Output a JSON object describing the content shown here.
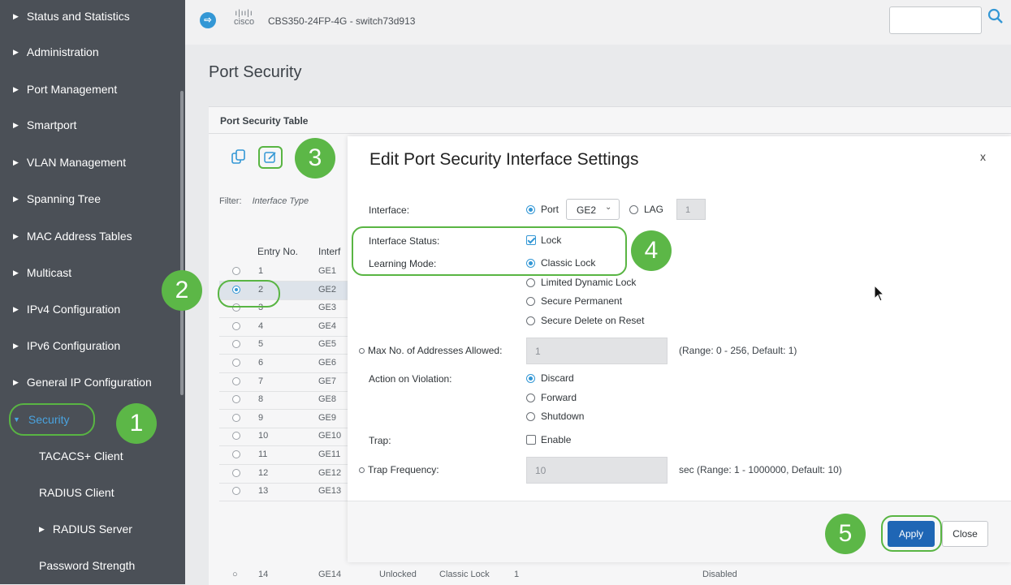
{
  "sidebar": {
    "items": [
      {
        "label": "Status and Statistics"
      },
      {
        "label": "Administration"
      },
      {
        "label": "Port Management"
      },
      {
        "label": "Smartport"
      },
      {
        "label": "VLAN Management"
      },
      {
        "label": "Spanning Tree"
      },
      {
        "label": "MAC Address Tables"
      },
      {
        "label": "Multicast"
      },
      {
        "label": "IPv4 Configuration"
      },
      {
        "label": "IPv6 Configuration"
      },
      {
        "label": "General IP Configuration"
      },
      {
        "label": "Security"
      }
    ],
    "subitems": [
      {
        "label": "TACACS+ Client"
      },
      {
        "label": "RADIUS Client"
      },
      {
        "label": "RADIUS Server"
      },
      {
        "label": "Password Strength"
      }
    ]
  },
  "header": {
    "brand": "cisco",
    "model": "CBS350-24FP-4G - switch73d913"
  },
  "page": {
    "title": "Port Security",
    "table_title": "Port Security Table",
    "filter_label": "Filter:",
    "filter_value": "Interface Type",
    "columns": [
      "Entry No.",
      "Interf"
    ],
    "rows": [
      {
        "num": "1",
        "port": "GE1"
      },
      {
        "num": "2",
        "port": "GE2"
      },
      {
        "num": "3",
        "port": "GE3"
      },
      {
        "num": "4",
        "port": "GE4"
      },
      {
        "num": "5",
        "port": "GE5"
      },
      {
        "num": "6",
        "port": "GE6"
      },
      {
        "num": "7",
        "port": "GE7"
      },
      {
        "num": "8",
        "port": "GE8"
      },
      {
        "num": "9",
        "port": "GE9"
      },
      {
        "num": "10",
        "port": "GE10"
      },
      {
        "num": "11",
        "port": "GE11"
      },
      {
        "num": "12",
        "port": "GE12"
      },
      {
        "num": "13",
        "port": "GE13"
      }
    ],
    "last_row": {
      "num": "14",
      "port": "GE14",
      "status": "Unlocked",
      "mode": "Classic Lock",
      "max": "1",
      "trap": "Disabled"
    }
  },
  "steps": [
    "1",
    "2",
    "3",
    "4",
    "5"
  ],
  "modal": {
    "title": "Edit Port Security Interface Settings",
    "close": "x",
    "interface_label": "Interface:",
    "port_label": "Port",
    "port_value": "GE2",
    "lag_label": "LAG",
    "lag_value": "1",
    "status_label": "Interface Status:",
    "status_option": "Lock",
    "learning_label": "Learning Mode:",
    "learning_options": [
      "Classic Lock",
      "Limited Dynamic Lock",
      "Secure Permanent",
      "Secure Delete on Reset"
    ],
    "max_label": "Max No. of Addresses Allowed:",
    "max_value": "1",
    "max_hint": "(Range: 0 - 256, Default: 1)",
    "violation_label": "Action on Violation:",
    "violation_options": [
      "Discard",
      "Forward",
      "Shutdown"
    ],
    "trap_label": "Trap:",
    "trap_option": "Enable",
    "trap_freq_label": "Trap Frequency:",
    "trap_freq_value": "10",
    "trap_freq_hint": "sec (Range: 1 - 1000000, Default: 10)",
    "apply": "Apply",
    "close_btn": "Close"
  },
  "colors": {
    "accent": "#1f66b5",
    "highlight": "#5cb747",
    "sidebar": "#4b5057"
  }
}
